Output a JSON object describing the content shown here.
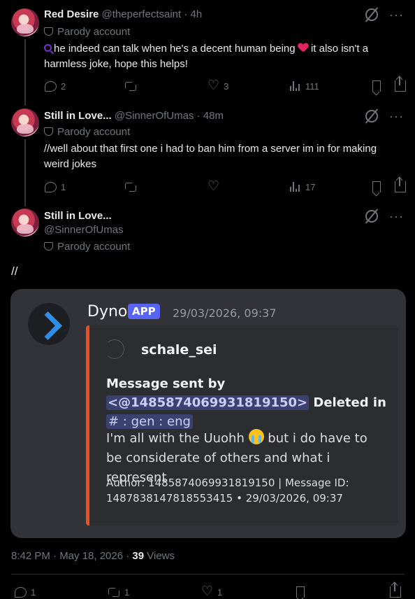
{
  "tweets": [
    {
      "name": "Red Desire",
      "handle": "@theperfectsaint",
      "time": "4h",
      "badge": "Parody account",
      "text_a": "he indeed can talk when he's a decent human being",
      "text_b": " it also isn't a harmless joke, hope this helps!",
      "replies": "2",
      "likes": "3",
      "views": "111"
    },
    {
      "name": "Still in Love...",
      "handle": "@SinnerOfUmas",
      "time": "48m",
      "badge": "Parody account",
      "text": "//well about that first one i had to ban him from a server im in for making weird jokes",
      "replies": "1",
      "views": "17"
    }
  ],
  "main": {
    "name": "Still in Love...",
    "handle": "@SinnerOfUmas",
    "badge": "Parody account",
    "text": "//",
    "timestamp": "8:42 PM · May 18, 2026 · ",
    "views_count": "39",
    "views_label": " Views",
    "replies": "1",
    "reposts": "1",
    "likes": "1"
  },
  "discord": {
    "bot_name": "Dyno",
    "bot_tag": "APP",
    "time": "29/03/2026, 09:37",
    "author": "schale_sei",
    "title_a": "Message sent by",
    "mention": "<@1485874069931819150>",
    "title_b": " Deleted in",
    "channel": "#  : gen : eng",
    "content_a": "I'm all with the Uuohh ",
    "content_b": " but i do have to be considerate of others and what i represent",
    "footer": "Author: 1485874069931819150 | Message ID: 1487838147818553415 • 29/03/2026, 09:37"
  },
  "icons": [
    "grok-icon",
    "more-icon",
    "reply-icon",
    "repost-icon",
    "like-icon",
    "views-icon",
    "bookmark-icon",
    "share-icon",
    "parody-mask-icon"
  ]
}
